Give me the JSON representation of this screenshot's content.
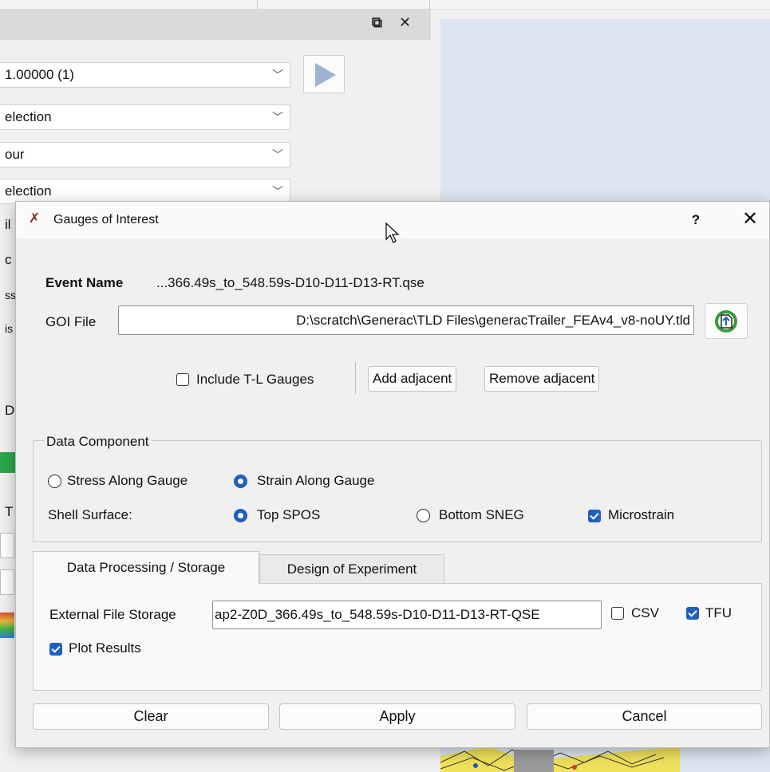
{
  "background": {
    "playback_combo": "1.00000 (1)",
    "combo_2": "election",
    "combo_3": "our",
    "combo_4": "election",
    "fragments": [
      "il",
      "c",
      "ss",
      "is",
      "D",
      "T"
    ]
  },
  "dialog": {
    "title": "Gauges of Interest",
    "help": "?",
    "close": "✕",
    "event_name_label": "Event Name",
    "event_name_value": "...366.49s_to_548.59s-D10-D11-D13-RT.qse",
    "goi_file_label": "GOI File",
    "goi_file_value": "D:\\scratch\\Generac\\TLD Files\\generacTrailer_FEAv4_v8-noUY.tld",
    "include_tl_label": "Include T-L Gauges",
    "include_tl_checked": false,
    "add_adjacent": "Add adjacent",
    "remove_adjacent": "Remove adjacent",
    "data_component": {
      "title": "Data Component",
      "stress_label": "Stress Along Gauge",
      "strain_label": "Strain Along Gauge",
      "selected": "strain",
      "shell_surface_label": "Shell Surface:",
      "top_label": "Top SPOS",
      "bottom_label": "Bottom SNEG",
      "surface_selected": "top",
      "microstrain_label": "Microstrain",
      "microstrain_checked": true
    },
    "tabs": [
      {
        "label": "Data Processing / Storage",
        "active": true
      },
      {
        "label": "Design of Experiment",
        "active": false
      }
    ],
    "storage": {
      "external_label": "External File Storage",
      "external_value": "ap2-Z0D_366.49s_to_548.59s-D10-D11-D13-RT-QSE",
      "csv_label": "CSV",
      "csv_checked": false,
      "tfu_label": "TFU",
      "tfu_checked": true,
      "plot_label": "Plot Results",
      "plot_checked": true
    },
    "buttons": {
      "clear": "Clear",
      "apply": "Apply",
      "cancel": "Cancel"
    }
  },
  "colors": {
    "accent": "#1f5fbf",
    "viewport": "#dce6f2",
    "dialog_bg": "#f0f0f0"
  }
}
